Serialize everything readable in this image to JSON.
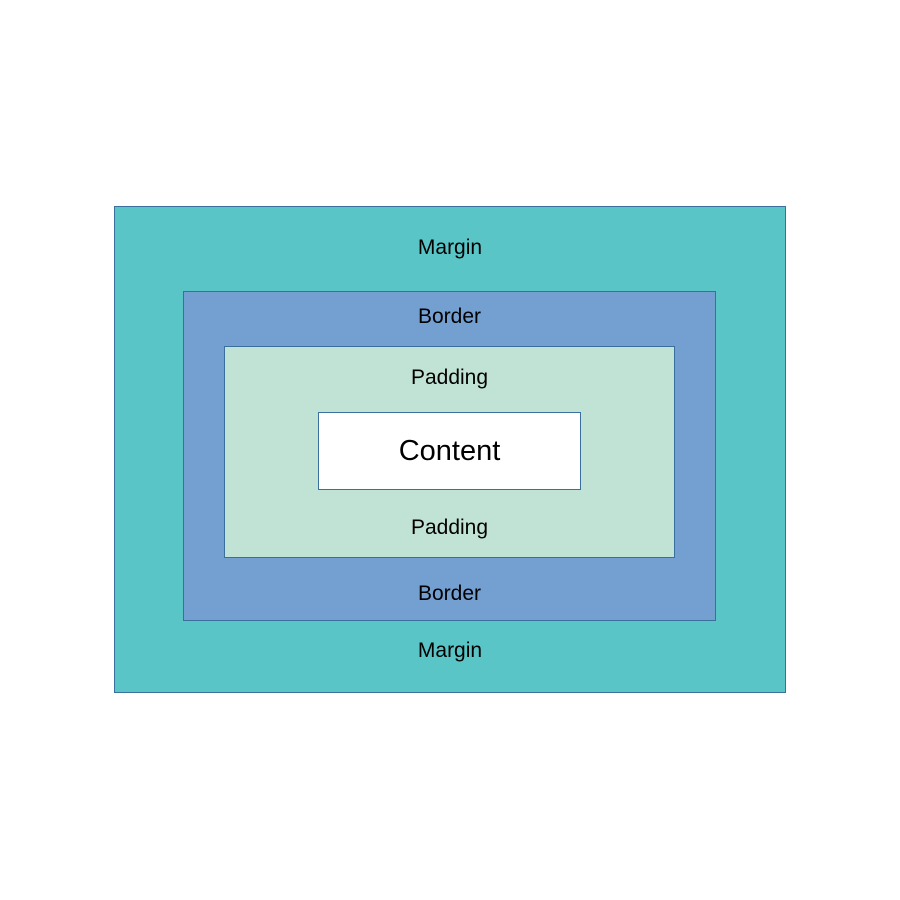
{
  "colors": {
    "margin": "#59c5c7",
    "border": "#739fd1",
    "padding": "#c1e3d5",
    "content": "#ffffff",
    "outline": "#3a6f9e"
  },
  "layers": {
    "margin": {
      "top_label": "Margin",
      "bottom_label": "Margin"
    },
    "border": {
      "top_label": "Border",
      "bottom_label": "Border"
    },
    "padding": {
      "top_label": "Padding",
      "bottom_label": "Padding"
    },
    "content": {
      "label": "Content"
    }
  }
}
